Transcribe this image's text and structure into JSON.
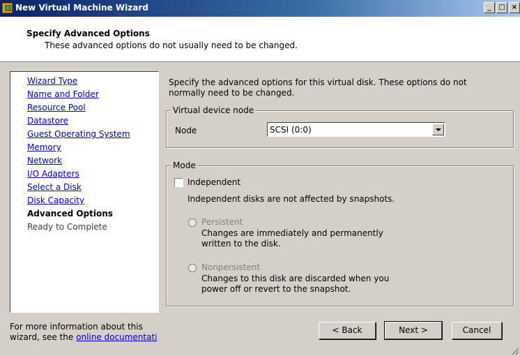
{
  "window": {
    "title": "New Virtual Machine Wizard"
  },
  "header": {
    "title": "Specify Advanced Options",
    "subtitle": "These advanced options do not usually need to be changed."
  },
  "nav": {
    "items": [
      {
        "label": "Wizard Type",
        "state": "link"
      },
      {
        "label": "Name and Folder",
        "state": "link"
      },
      {
        "label": "Resource Pool",
        "state": "link"
      },
      {
        "label": "Datastore",
        "state": "link"
      },
      {
        "label": "Guest Operating System",
        "state": "link"
      },
      {
        "label": "Memory",
        "state": "link"
      },
      {
        "label": "Network",
        "state": "link"
      },
      {
        "label": "I/O Adapters",
        "state": "link"
      },
      {
        "label": "Select a Disk",
        "state": "link"
      },
      {
        "label": "Disk Capacity",
        "state": "link"
      },
      {
        "label": "Advanced Options",
        "state": "current"
      },
      {
        "label": "Ready to Complete",
        "state": "future"
      }
    ]
  },
  "main": {
    "description": "Specify the advanced options for this virtual disk. These options do not normally need to be changed.",
    "virtual_device_node": {
      "legend": "Virtual device node",
      "node_label": "Node",
      "node_value": "SCSI (0:0)"
    },
    "mode": {
      "legend": "Mode",
      "independent_label": "Independent",
      "independent_checked": false,
      "independent_desc": "Independent disks are not affected by snapshots.",
      "persistent_label": "Persistent",
      "persistent_desc": "Changes are immediately and permanently written to the disk.",
      "nonpersistent_label": "Nonpersistent",
      "nonpersistent_desc": "Changes to this disk are discarded when you power off or revert to the snapshot."
    }
  },
  "footer": {
    "info_text": "For more information about this wizard, see the",
    "info_link": "online documentati",
    "back_label": "< Back",
    "next_label": "Next >",
    "cancel_label": "Cancel"
  }
}
